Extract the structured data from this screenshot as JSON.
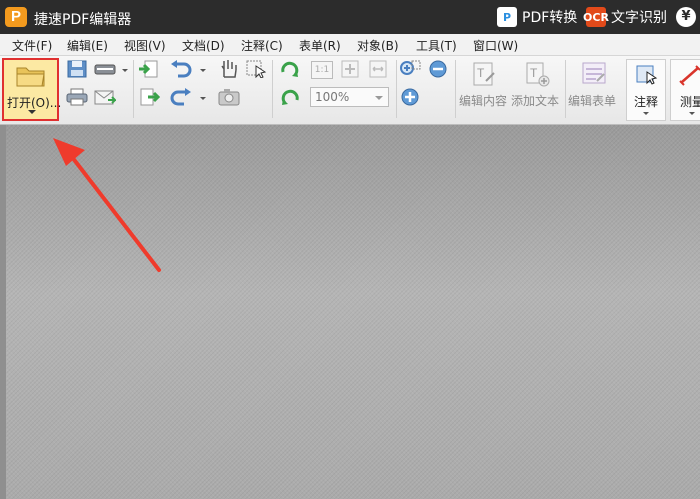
{
  "app": {
    "logo_letter": "P",
    "title": "捷速PDF编辑器"
  },
  "titlebar": {
    "pdf_convert": "PDF转换",
    "pdf_icon_text": "P",
    "ocr_icon_text": "OCR",
    "ocr": "文字识别",
    "currency": "¥"
  },
  "menu": [
    {
      "label": "文件(F)"
    },
    {
      "label": "编辑(E)"
    },
    {
      "label": "视图(V)"
    },
    {
      "label": "文档(D)"
    },
    {
      "label": "注释(C)"
    },
    {
      "label": "表单(R)"
    },
    {
      "label": "对象(B)"
    },
    {
      "label": "工具(T)"
    },
    {
      "label": "窗口(W)"
    }
  ],
  "toolbar": {
    "open_label": "打开(O)...",
    "fit_label": "1:1",
    "zoom_value": "100%",
    "edit_content": "编辑内容",
    "add_text": "添加文本",
    "edit_form": "编辑表单",
    "annotate": "注释",
    "measure": "测量"
  },
  "colors": {
    "accent_highlight": "#fce9a3",
    "callout_red": "#e03030",
    "titlebar": "#2c2c2c"
  }
}
